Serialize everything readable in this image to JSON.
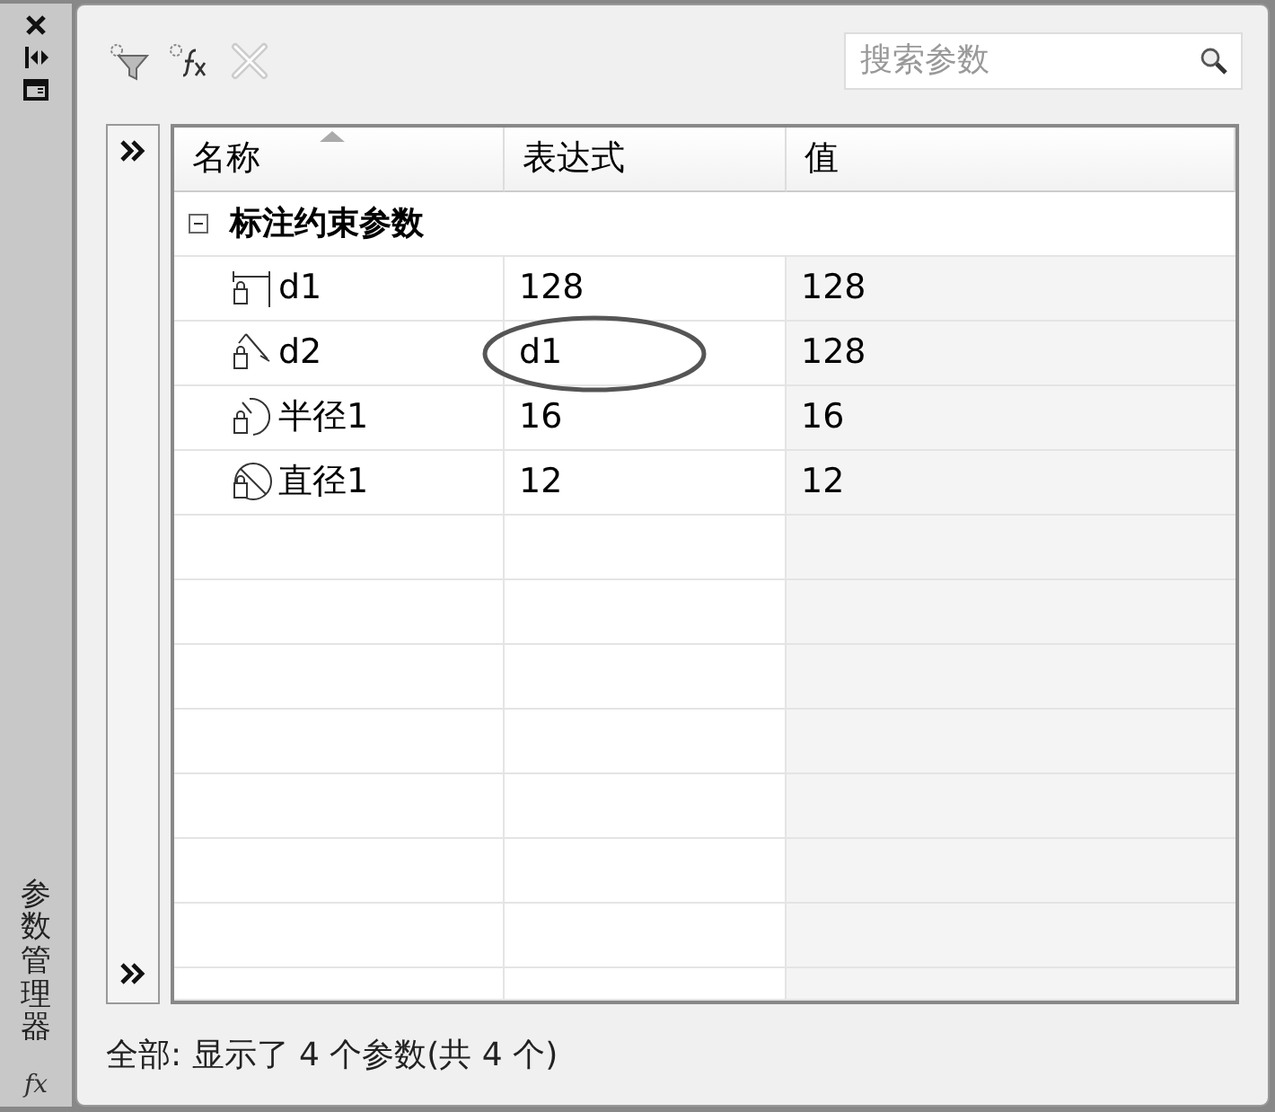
{
  "side_strip": {
    "title": "参数管理器",
    "fx_label": "fx"
  },
  "toolbar": {
    "search": {
      "placeholder": "搜索参数"
    },
    "delete_disabled": true
  },
  "table": {
    "columns": [
      {
        "label": "名称",
        "sorted": true
      },
      {
        "label": "表达式",
        "sorted": false
      },
      {
        "label": "值",
        "sorted": false
      }
    ],
    "group": {
      "label": "标注约束参数",
      "expanded": true
    },
    "rows": [
      {
        "kind": "linear",
        "name": "d1",
        "expression": "128",
        "value": "128",
        "circled": false
      },
      {
        "kind": "aligned",
        "name": "d2",
        "expression": "d1",
        "value": "128",
        "circled": true
      },
      {
        "kind": "radius",
        "name": "半径1",
        "expression": "16",
        "value": "16",
        "circled": false
      },
      {
        "kind": "diameter",
        "name": "直径1",
        "expression": "12",
        "value": "12",
        "circled": false
      }
    ]
  },
  "status_bar": "全部: 显示了 4 个参数(共 4 个)"
}
